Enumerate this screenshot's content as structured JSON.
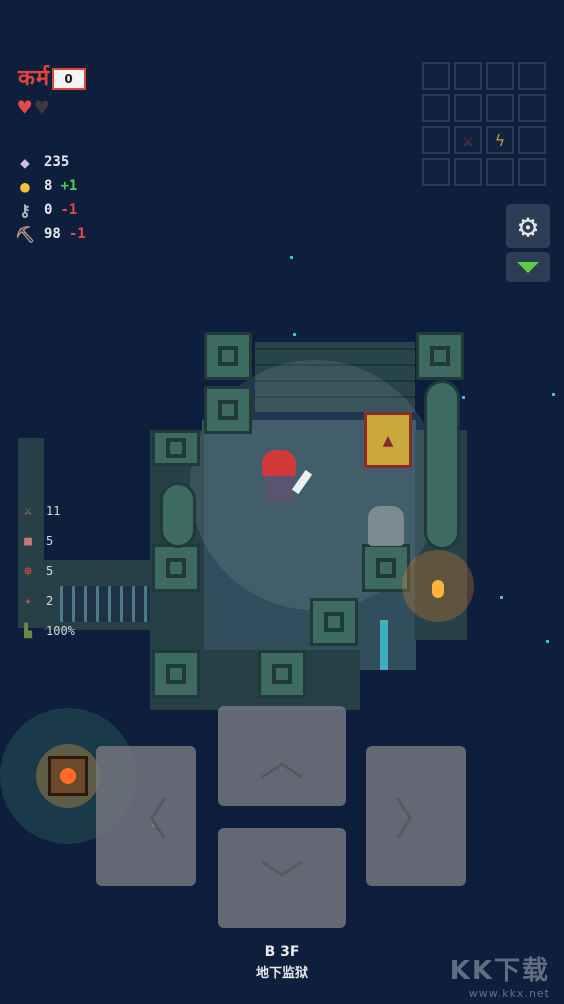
{
  "hud": {
    "logo_text": "कर्म",
    "logo_badge": "0",
    "hearts": [
      "full",
      "empty"
    ],
    "stats": [
      {
        "icon": "gem-icon",
        "value": "235",
        "delta": "",
        "delta_type": ""
      },
      {
        "icon": "gold-coin-icon",
        "value": "8",
        "delta": "+1",
        "delta_type": "pos"
      },
      {
        "icon": "key-icon",
        "value": "0",
        "delta": "-1",
        "delta_type": "neg"
      },
      {
        "icon": "pickaxe-icon",
        "value": "98",
        "delta": "-1",
        "delta_type": "neg"
      }
    ]
  },
  "inventory": {
    "rows": 4,
    "cols": 4,
    "items": [
      {
        "slot": 9,
        "icon": "sword-icon"
      },
      {
        "slot": 10,
        "icon": "lightning-icon"
      }
    ]
  },
  "side_stats": [
    {
      "icon": "attack-icon",
      "value": "11"
    },
    {
      "icon": "defense-icon",
      "value": "5"
    },
    {
      "icon": "crit-icon",
      "value": "5"
    },
    {
      "icon": "speed-icon",
      "value": "2"
    },
    {
      "icon": "boots-icon",
      "value": "100%"
    }
  ],
  "floor": {
    "code": "B 3F",
    "name": "地下监狱"
  },
  "watermark": {
    "brand": "KK下载",
    "url": "www.kkx.net"
  },
  "colors": {
    "background": "#0d1f3c",
    "accent_red": "#e0453a",
    "positive": "#4ed04e",
    "negative": "#e84848"
  }
}
